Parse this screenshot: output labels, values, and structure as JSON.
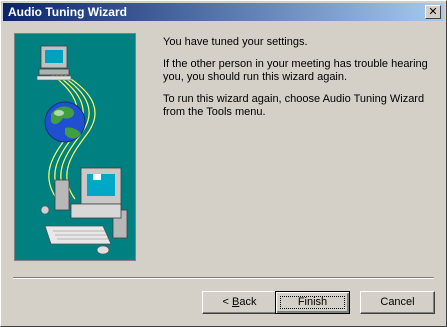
{
  "window": {
    "title": "Audio Tuning Wizard",
    "close_glyph": "✕"
  },
  "messages": [
    "You have tuned your settings.",
    "If the other person in your meeting has trouble hearing you, you should run this wizard again.",
    "To run this wizard again, choose Audio Tuning Wizard from the Tools menu."
  ],
  "buttons": {
    "back_arrow": "< ",
    "back_mnemonic": "B",
    "back_rest": "ack",
    "finish": "Finish",
    "cancel": "Cancel"
  },
  "colors": {
    "illustration_bg": "#008080",
    "titlebar_start": "#0a246a",
    "titlebar_end": "#a6caf0",
    "dialog_bg": "#d4d0c8"
  },
  "icons": [
    "close-icon",
    "remote-computer-icon",
    "globe-icon",
    "local-computer-icon"
  ]
}
